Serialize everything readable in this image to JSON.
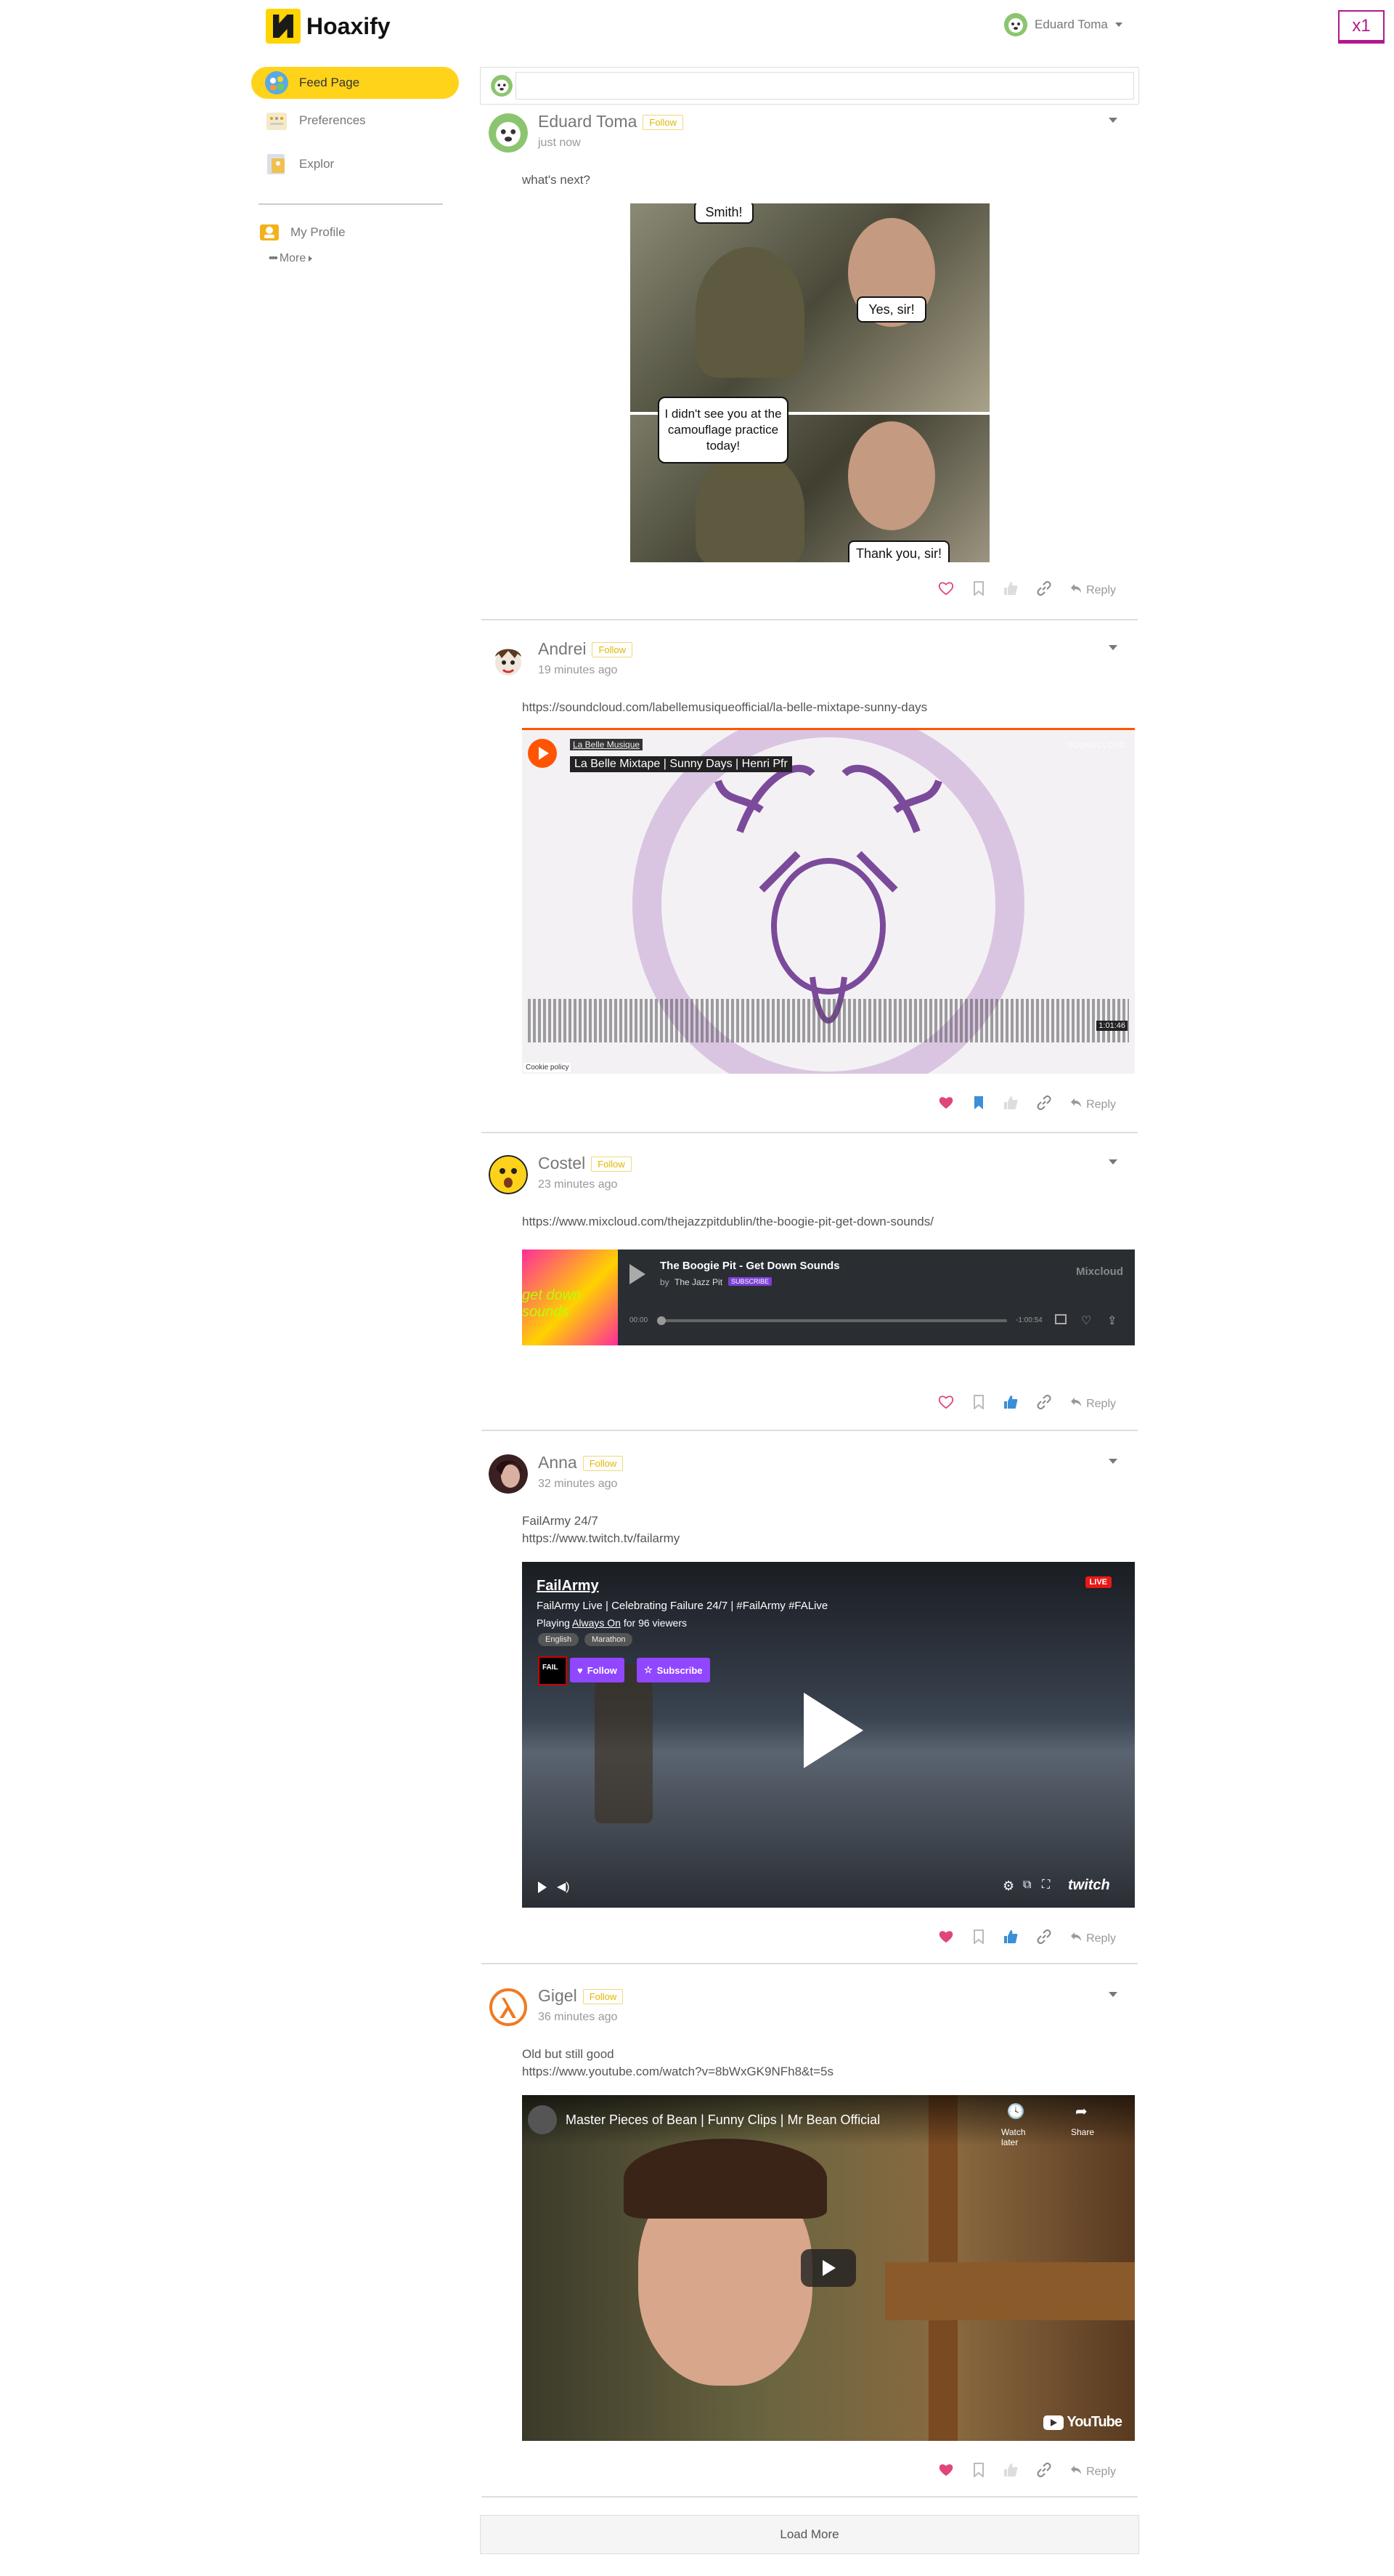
{
  "app": {
    "name": "Hoaxify",
    "zoom_badge": "x1"
  },
  "user_menu": {
    "username": "Eduard Toma"
  },
  "sidebar": {
    "items": [
      {
        "label": "Feed Page",
        "icon": "feed-icon"
      },
      {
        "label": "Preferences",
        "icon": "preferences-icon"
      },
      {
        "label": "Explor",
        "icon": "explore-icon"
      },
      {
        "label": "My Profile",
        "icon": "profile-icon"
      },
      {
        "label": "More",
        "icon": "more-dots-icon"
      }
    ]
  },
  "composer": {
    "placeholder": ""
  },
  "follow_label": "Follow",
  "reply_label": "Reply",
  "posts": [
    {
      "author": "Eduard Toma",
      "time": "just now",
      "text": "what's next?",
      "meme": {
        "bubble1": "Smith!",
        "bubble2": "Yes, sir!",
        "bubble3": "I didn't see you at the camouflage practice today!",
        "bubble4": "Thank you, sir!"
      }
    },
    {
      "author": "Andrei",
      "time": "19 minutes ago",
      "text": "https://soundcloud.com/labellemusiqueofficial/la-belle-mixtape-sunny-days",
      "embed": {
        "artist": "La Belle Musique",
        "title": "La Belle Mixtape | Sunny Days | Henri Pfr",
        "brand": "SOUNDCLOUD",
        "duration": "1:01:46",
        "cookie": "Cookie policy"
      }
    },
    {
      "author": "Costel",
      "time": "23 minutes ago",
      "text": "https://www.mixcloud.com/thejazzpitdublin/the-boogie-pit-get-down-sounds/",
      "embed": {
        "title": "The Boogie Pit - Get Down Sounds",
        "by": "by",
        "artist": "The Jazz Pit",
        "badge": "SUBSCRIBE",
        "brand": "Mixcloud",
        "start": "00:00",
        "end": "-1:00:54",
        "art_text": "get down sounds"
      }
    },
    {
      "author": "Anna",
      "time": "32 minutes ago",
      "text1": "FailArmy 24/7",
      "text2": "https://www.twitch.tv/failarmy",
      "embed": {
        "channel": "FailArmy",
        "title": "FailArmy Live | Celebrating Failure 24/7 | #FailArmy #FALive",
        "playing_prefix": "Playing",
        "playing_game": "Always On",
        "playing_suffix": "for 96 viewers",
        "tags": [
          "English",
          "Marathon"
        ],
        "live": "LIVE",
        "follow": "Follow",
        "subscribe": "Subscribe",
        "brand": "twitch"
      }
    },
    {
      "author": "Gigel",
      "time": "36 minutes ago",
      "text1": "Old but still good",
      "text2": "https://www.youtube.com/watch?v=8bWxGK9NFh8&t=5s",
      "embed": {
        "title": "Master Pieces of Bean | Funny Clips | Mr Bean Official",
        "watch_later": "Watch later",
        "share": "Share",
        "brand": "YouTube"
      }
    }
  ],
  "load_more": "Load More",
  "colors": {
    "accent": "#ffd31a",
    "like": "#e0457b",
    "bookmark": "#3b8fd6",
    "upvote": "#3b8fd6",
    "soundcloud": "#ff5500",
    "twitch": "#9146ff",
    "live": "#e91916"
  }
}
